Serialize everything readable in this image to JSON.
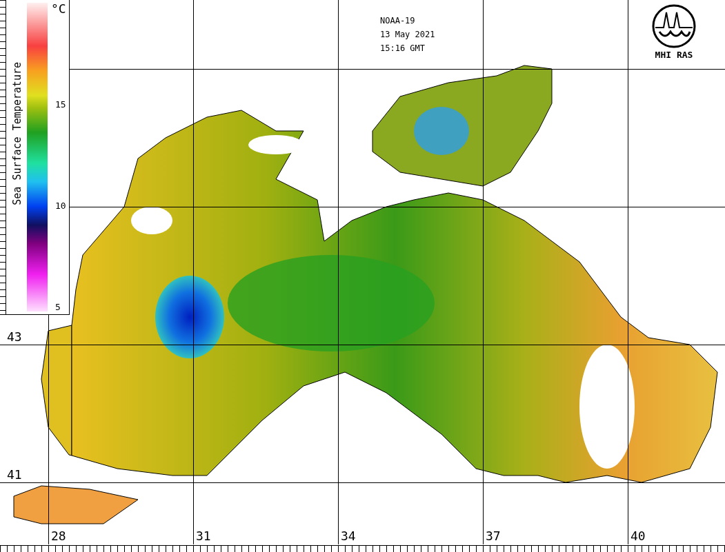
{
  "header": {
    "satellite": "NOAA-19",
    "date": "13 May 2021",
    "time": "15:16 GMT"
  },
  "logo": {
    "text": "MHI RAS"
  },
  "legend": {
    "title": "Sea Surface Temperature",
    "unit": "°C",
    "ticks": [
      "15",
      "10",
      "5"
    ]
  },
  "map": {
    "latitude_labels": [
      "43",
      "41"
    ],
    "longitude_labels": [
      "28",
      "31",
      "34",
      "37",
      "40"
    ]
  }
}
